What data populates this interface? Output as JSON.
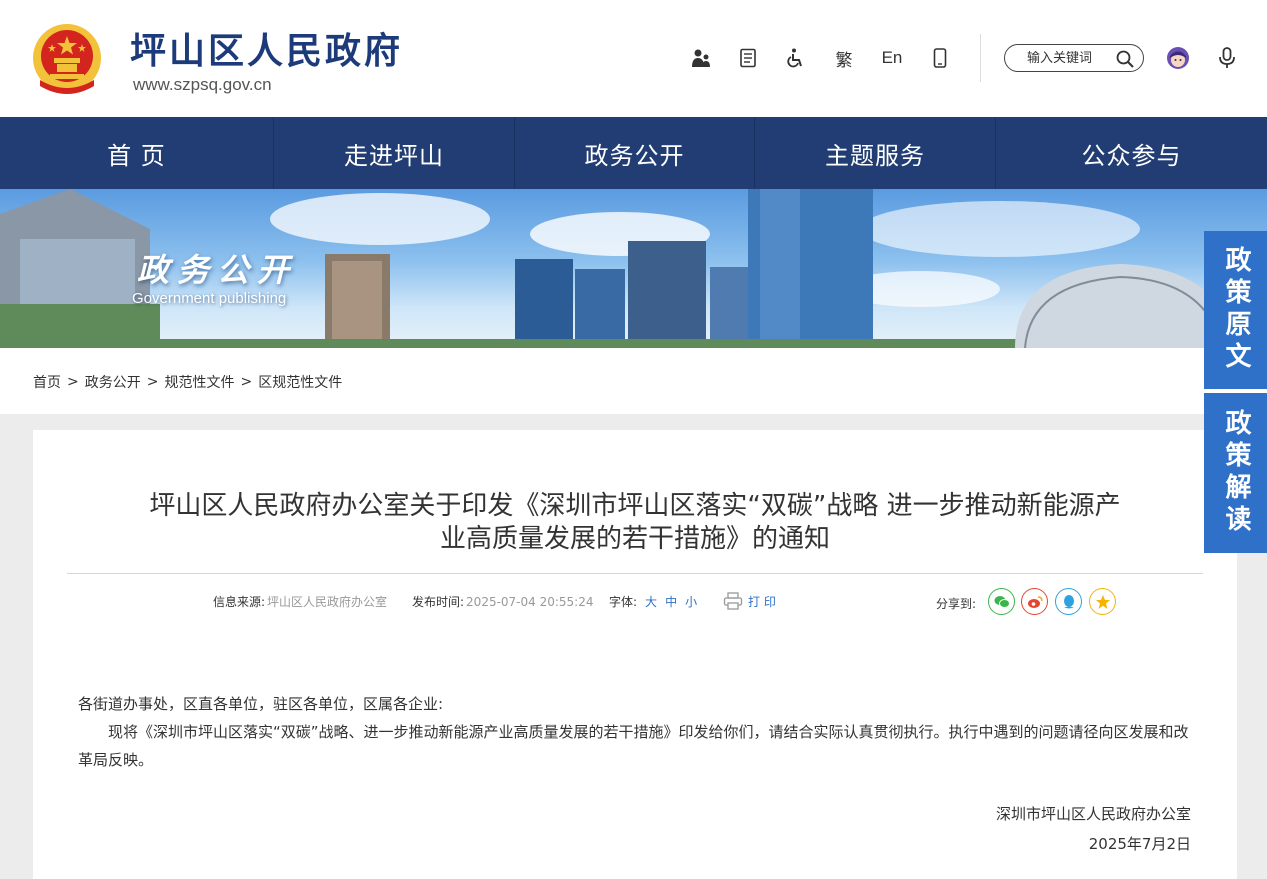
{
  "header": {
    "site_title": "坪山区人民政府",
    "site_url": "www.szpsq.gov.cn",
    "tools": {
      "traditional": "繁",
      "english": "En"
    },
    "search_placeholder": "输入关键词"
  },
  "nav": {
    "items": [
      {
        "label": "首 页"
      },
      {
        "label": "走进坪山"
      },
      {
        "label": "政务公开"
      },
      {
        "label": "主题服务"
      },
      {
        "label": "公众参与"
      }
    ]
  },
  "banner": {
    "title": "政务公开",
    "subtitle": "Government publishing"
  },
  "breadcrumb": {
    "items": [
      "首页",
      "政务公开",
      "规范性文件",
      "区规范性文件"
    ],
    "separator": ">"
  },
  "side_tabs": {
    "original": "政策原文",
    "interpretation": "政策解读"
  },
  "article": {
    "title_line1": "坪山区人民政府办公室关于印发《深圳市坪山区落实“双碳”战略 进一步推动新能源产",
    "title_line2": "业高质量发展的若干措施》的通知",
    "meta": {
      "source_label": "信息来源:",
      "source_value": "坪山区人民政府办公室",
      "time_label": "发布时间:",
      "time_value": "2025-07-04 20:55:24",
      "font_label": "字体:",
      "font_large": "大",
      "font_medium": "中",
      "font_small": "小",
      "print_label": "打 印"
    },
    "share_label": "分享到:",
    "salutation": "各街道办事处，区直各单位，驻区各单位，区属各企业:",
    "paragraph": "现将《深圳市坪山区落实“双碳”战略、进一步推动新能源产业高质量发展的若干措施》印发给你们，请结合实际认真贯彻执行。执行中遇到的问题请径向区发展和改革局反映。",
    "signature_org": "深圳市坪山区人民政府办公室",
    "signature_date": "2025年7月2日"
  },
  "colors": {
    "nav_bg": "#223d73",
    "title_blue": "#1d3b7a",
    "side_tab_blue": "#2f70c8",
    "emblem_red": "#d3241d",
    "emblem_gold": "#f2c23b",
    "wechat_green": "#3bb54a",
    "weibo_red": "#e6452f",
    "qq_blue": "#2ea2e0",
    "favorite_yellow": "#f5b400"
  },
  "icons": [
    "emblem-icon",
    "accessibility-people-icon",
    "document-icon",
    "wheelchair-icon",
    "mobile-icon",
    "search-icon",
    "avatar-icon",
    "microphone-icon",
    "print-icon",
    "wechat-icon",
    "weibo-icon",
    "qq-icon",
    "favorite-star-icon"
  ]
}
